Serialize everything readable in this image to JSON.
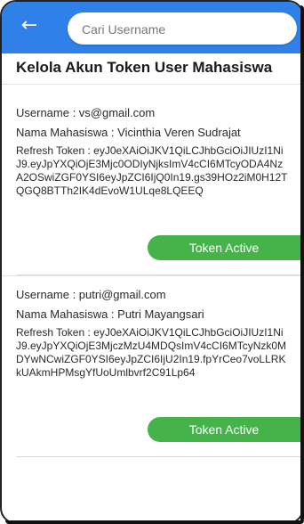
{
  "app_bar": {
    "back_icon": "arrow-left-icon",
    "search_placeholder": "Cari Username"
  },
  "page": {
    "title": "Kelola Akun Token User Mahasiswa"
  },
  "users": [
    {
      "username_line": "Username : vs@gmail.com",
      "name_line": "Nama Mahasiswa : Vicinthia Veren Sudrajat",
      "token_line": "Refresh Token : eyJ0eXAiOiJKV1QiLCJhbGciOiJIUzI1NiJ9.eyJpYXQiOjE3Mjc0ODIyNjksImV4cCI6MTcyODA4NzA2OSwiZGF0YSI6eyJpZCI6IjQ0In19.gs39HOz2iM0H12TQGQ8BTTh2IK4dEvoW1ULqe8LQEEQ",
      "button": "Token Active"
    },
    {
      "username_line": "Username : putri@gmail.com",
      "name_line": "Nama Mahasiswa : Putri Mayangsari",
      "token_line": "Refresh Token : eyJ0eXAiOiJKV1QiLCJhbGciOiJIUzI1NiJ9.eyJpYXQiOjE3MjczMzU4MDQsImV4cCI6MTcyNzk0MDYwNCwiZGF0YSI6eyJpZCI6IjU2In19.fpYrCeo7voLLRKkUAkmHPMsgYfUoUmlbvrf2C91Lp64",
      "button": "Token Active"
    }
  ],
  "colors": {
    "app_bar": "#2f80e8",
    "button": "#44b34a"
  }
}
